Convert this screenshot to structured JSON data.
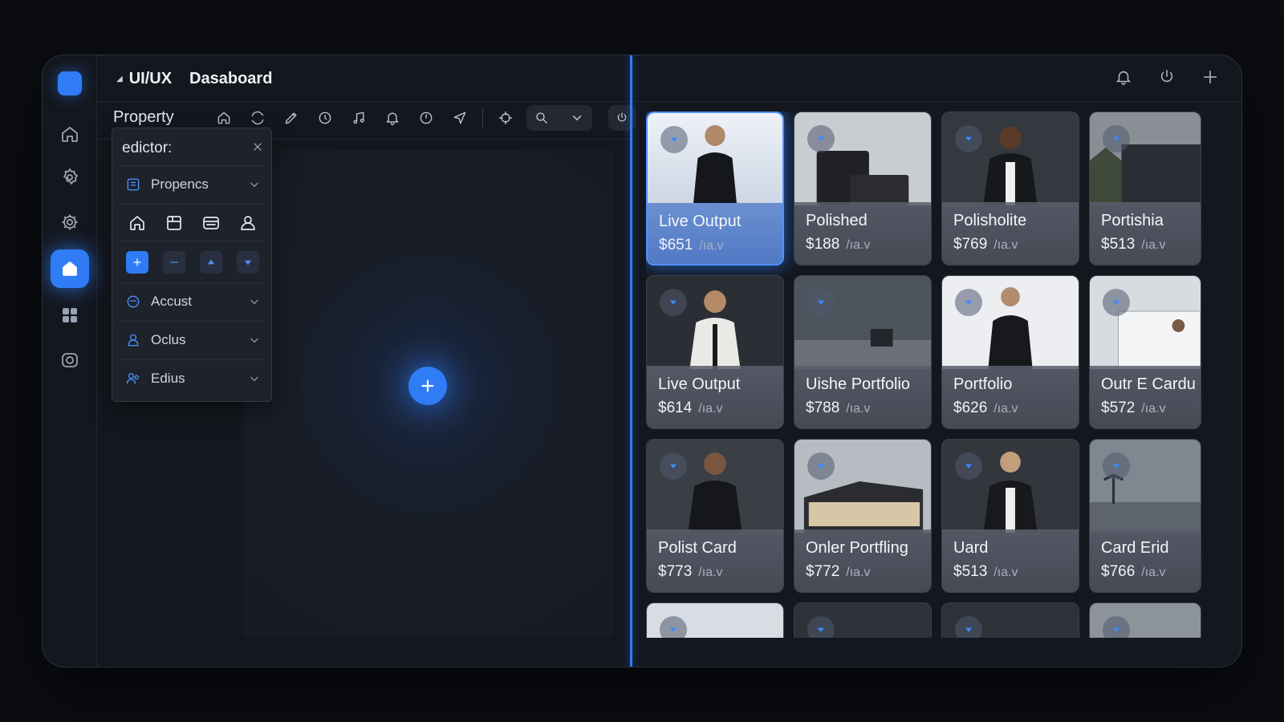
{
  "header": {
    "crumb1": "UI/UX",
    "crumb2": "Dasaboard"
  },
  "toolbar": {
    "title": "Property",
    "tools": [
      "home-icon",
      "refresh-icon",
      "pen-icon",
      "clock-icon",
      "music-icon",
      "bell-icon",
      "clock-alt-icon",
      "send-icon",
      "target-icon"
    ]
  },
  "editor": {
    "title": "edictor:",
    "rows": {
      "propencs": "Propencs",
      "accust": "Accust",
      "oclus": "Oclus",
      "edius": "Edius"
    }
  },
  "cards": [
    {
      "name": "Live Output",
      "price": "$651",
      "unit": "/ıa.v",
      "selected": true
    },
    {
      "name": "Polished",
      "price": "$188",
      "unit": "/ıa.v"
    },
    {
      "name": "Polisholite",
      "price": "$769",
      "unit": "/ıa.v"
    },
    {
      "name": "Portishia",
      "price": "$513",
      "unit": "/ıa.v"
    },
    {
      "name": "Live Output",
      "price": "$614",
      "unit": "/ıa.v"
    },
    {
      "name": "Uishe Portfolio",
      "price": "$788",
      "unit": "/ıa.v"
    },
    {
      "name": "Portfolio",
      "price": "$626",
      "unit": "/ıa.v"
    },
    {
      "name": "Outr E Cardu",
      "price": "$572",
      "unit": "/ıa.v"
    },
    {
      "name": "Polist Card",
      "price": "$773",
      "unit": "/ıa.v"
    },
    {
      "name": "Onler Portfling",
      "price": "$772",
      "unit": "/ıa.v"
    },
    {
      "name": "Uard",
      "price": "$513",
      "unit": "/ıa.v"
    },
    {
      "name": "Card Erid",
      "price": "$766",
      "unit": "/ıa.v"
    }
  ],
  "colors": {
    "accent": "#2f7cf6",
    "background": "#0b0d12",
    "panel": "#14171e"
  }
}
